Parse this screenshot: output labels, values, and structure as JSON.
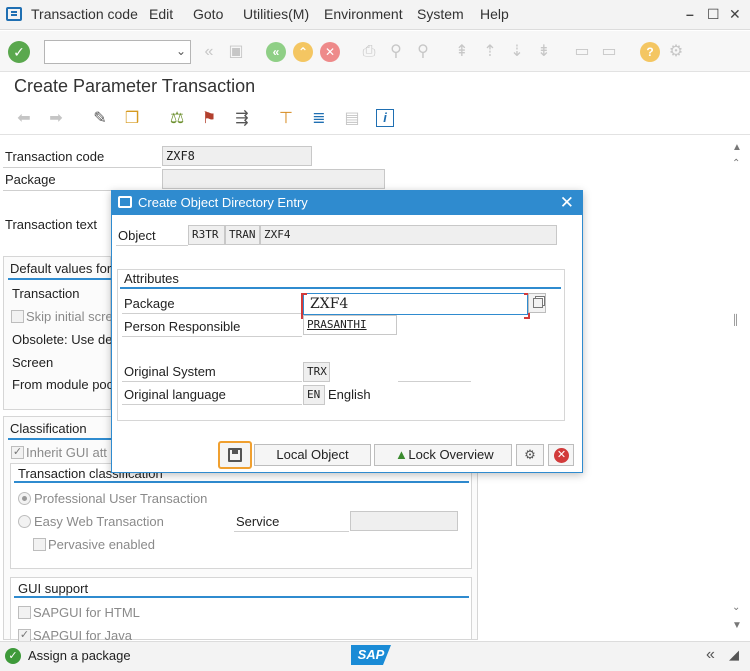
{
  "menubar": {
    "items": [
      "Transaction code",
      "Edit",
      "Goto",
      "Utilities(M)",
      "Environment",
      "System",
      "Help"
    ]
  },
  "toolbar": {
    "command_field_value": ""
  },
  "page_title": "Create Parameter Transaction",
  "form": {
    "transaction_code_label": "Transaction code",
    "transaction_code_value": "ZXF8",
    "package_label": "Package",
    "package_value": "",
    "transaction_text_label": "Transaction text",
    "default_values_header": "Default values for",
    "transaction_label": "Transaction",
    "skip_initial_label": "Skip initial scre",
    "obsolete_label": "Obsolete: Use de",
    "screen_label": "Screen",
    "from_module_label": "From module poo",
    "classification_header": "Classification",
    "inherit_gui_label": "Inherit GUI att",
    "transaction_classification_header": "Transaction classification",
    "professional_label": "Professional User Transaction",
    "easy_web_label": "Easy Web Transaction",
    "service_label": "Service",
    "service_value": "",
    "pervasive_label": "Pervasive enabled",
    "gui_support_header": "GUI support",
    "sapgui_html_label": "SAPGUI for HTML",
    "sapgui_java_label": "SAPGUI for Java"
  },
  "dialog": {
    "title": "Create Object Directory Entry",
    "object_label": "Object",
    "object_pgmid": "R3TR",
    "object_type": "TRAN",
    "object_name": "ZXF4",
    "attributes_header": "Attributes",
    "package_label": "Package",
    "package_value": "ZXF4",
    "person_label": "Person Responsible",
    "person_value": "PRASANTHI",
    "original_system_label": "Original System",
    "original_system_value": "TRX",
    "original_language_label": "Original language",
    "original_language_code": "EN",
    "original_language_name": "English",
    "local_object_label": "Local Object",
    "lock_overview_label": "Lock Overview"
  },
  "status": {
    "message": "Assign a package",
    "logo_text": "SAP"
  },
  "colors": {
    "accent": "#2f8bcf",
    "ok_green": "#5aa84e",
    "cancel_red": "#d23b3b",
    "highlight_orange": "#f0a030"
  }
}
